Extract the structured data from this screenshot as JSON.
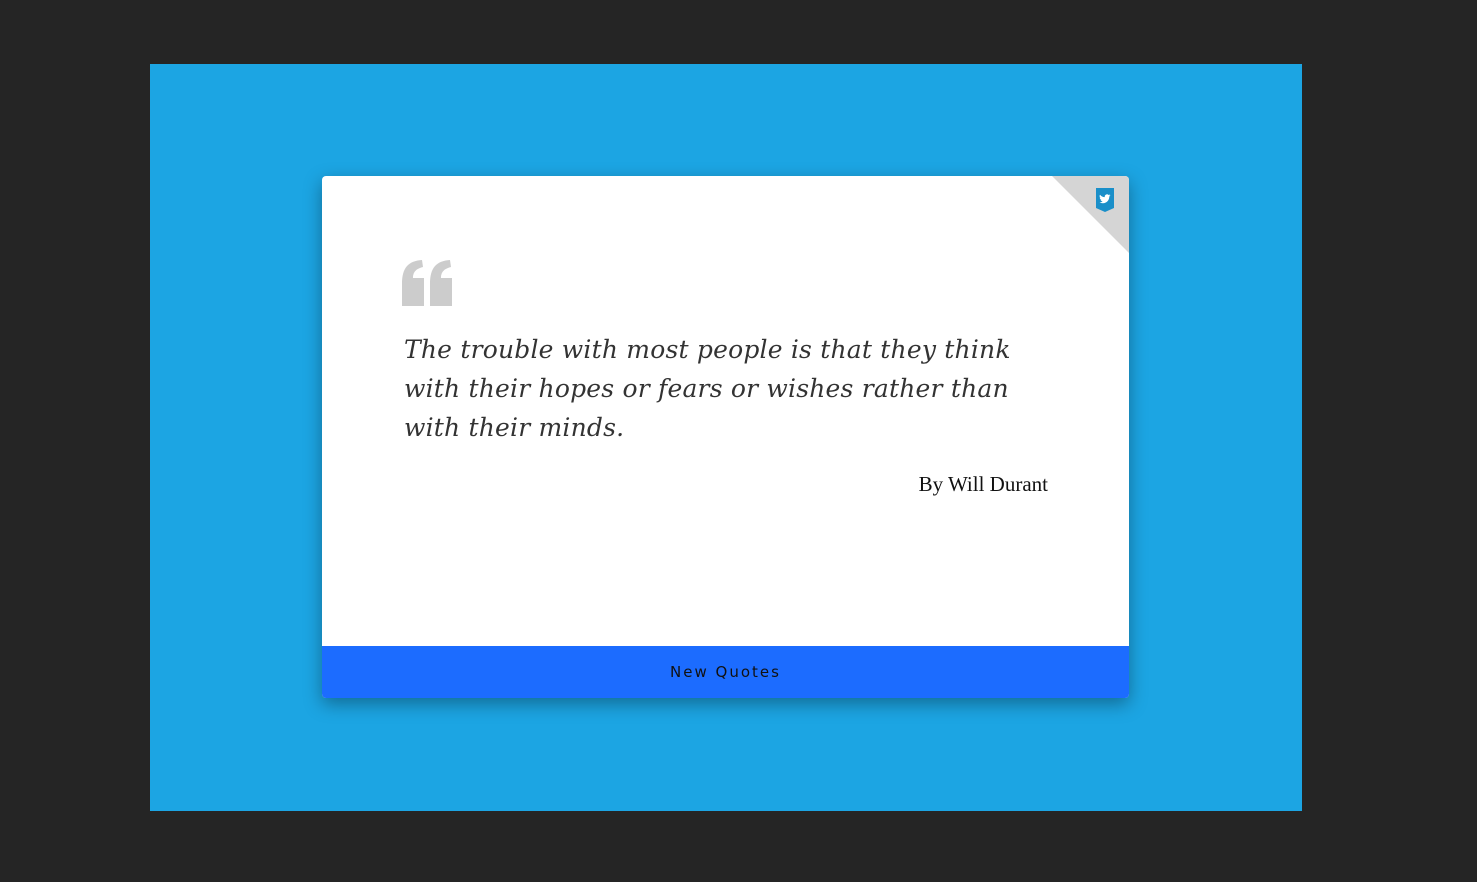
{
  "quote": {
    "text": "The trouble with most people is that they think with their hopes or fears or wishes rather than with their minds.",
    "author": "By Will Durant"
  },
  "actions": {
    "new_quote_label": "New Quotes",
    "tweet_icon": "twitter-icon"
  },
  "colors": {
    "page_background": "#252525",
    "frame_background": "#1ca5e3",
    "card_background": "#ffffff",
    "button_background": "#1c6cff",
    "quote_mark": "#cccccc",
    "tweet_icon": "#1a8fc9"
  }
}
